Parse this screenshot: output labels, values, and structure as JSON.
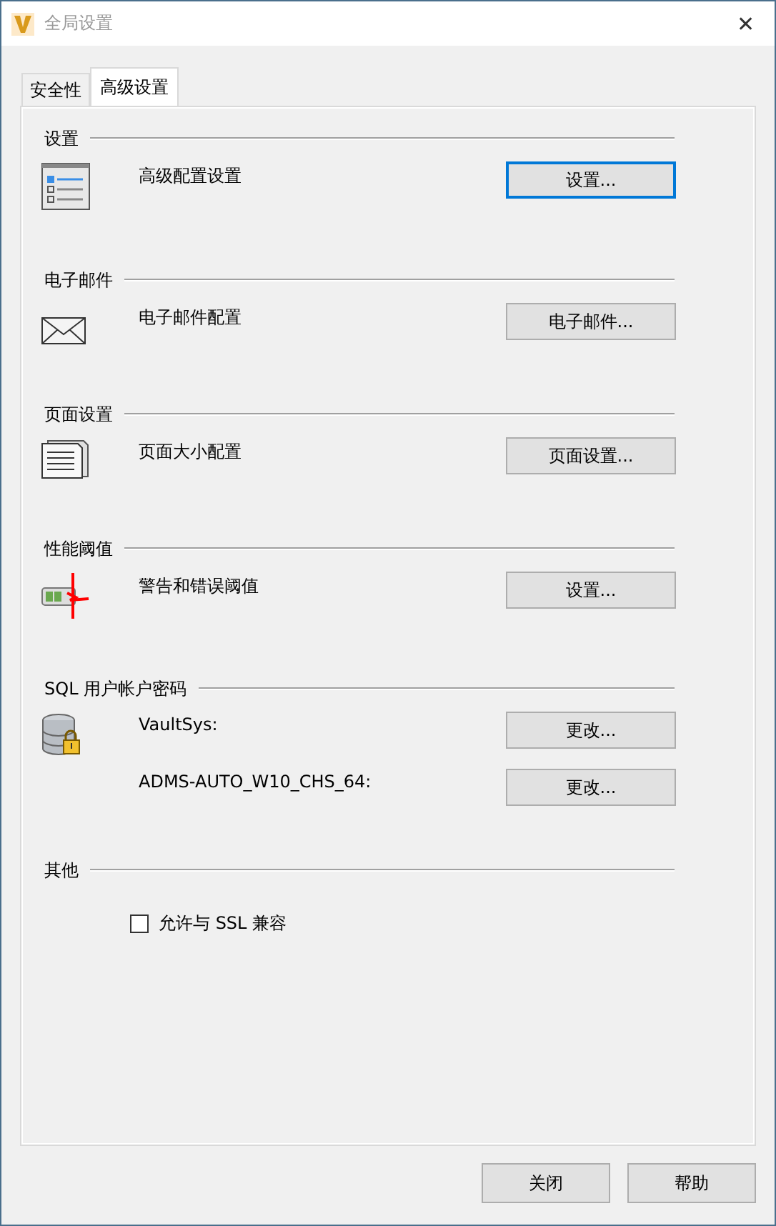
{
  "window": {
    "title": "全局设置",
    "close": "✕"
  },
  "tabs": [
    {
      "label": "安全性",
      "selected": false
    },
    {
      "label": "高级设置",
      "selected": true
    }
  ],
  "sections": [
    {
      "title": "设置",
      "kind": "rows",
      "rows": [
        {
          "label": "高级配置设置",
          "button": "设置...",
          "focused": true
        }
      ]
    },
    {
      "title": "电子邮件",
      "kind": "rows",
      "rows": [
        {
          "label": "电子邮件配置",
          "button": "电子邮件...",
          "focused": false
        }
      ]
    },
    {
      "title": "页面设置",
      "kind": "rows",
      "rows": [
        {
          "label": "页面大小配置",
          "button": "页面设置...",
          "focused": false
        }
      ]
    },
    {
      "title": "性能阈值",
      "kind": "rows",
      "rows": [
        {
          "label": "警告和错误阈值",
          "button": "设置...",
          "focused": false
        }
      ]
    },
    {
      "title": "SQL 用户帐户密码",
      "kind": "rows",
      "rows": [
        {
          "label": "VaultSys:",
          "button": "更改...",
          "focused": false
        },
        {
          "label": "ADMS-AUTO_W10_CHS_64:",
          "button": "更改...",
          "focused": false
        }
      ]
    },
    {
      "title": "其他",
      "kind": "checks",
      "checks": [
        {
          "label": "允许与 SSL 兼容",
          "checked": false
        }
      ]
    }
  ],
  "buttons": [
    "关闭",
    "帮助"
  ]
}
